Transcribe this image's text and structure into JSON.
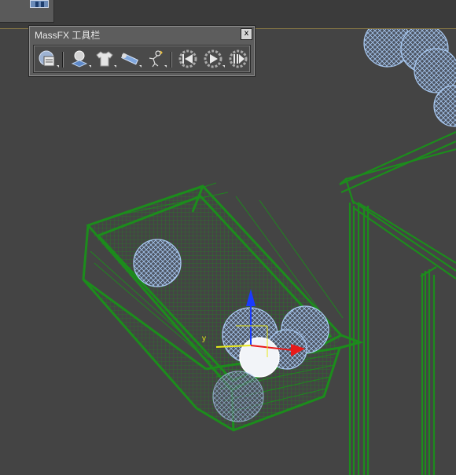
{
  "toolbar": {
    "title": "MassFX 工具栏",
    "close_label": "x",
    "buttons": [
      {
        "name": "world-parameters-icon"
      },
      {
        "name": "rigid-body-icon"
      },
      {
        "name": "mcloth-icon"
      },
      {
        "name": "constraint-icon"
      },
      {
        "name": "ragdoll-icon"
      },
      {
        "name": "reset-simulation-icon"
      },
      {
        "name": "start-simulation-icon"
      },
      {
        "name": "step-simulation-icon"
      }
    ]
  },
  "scene": {
    "basket_color": "#1c8c1c",
    "sphere_color": "#a8c8f0",
    "viewport_bg": "#444444",
    "gizmo": {
      "y_label": "y"
    }
  }
}
